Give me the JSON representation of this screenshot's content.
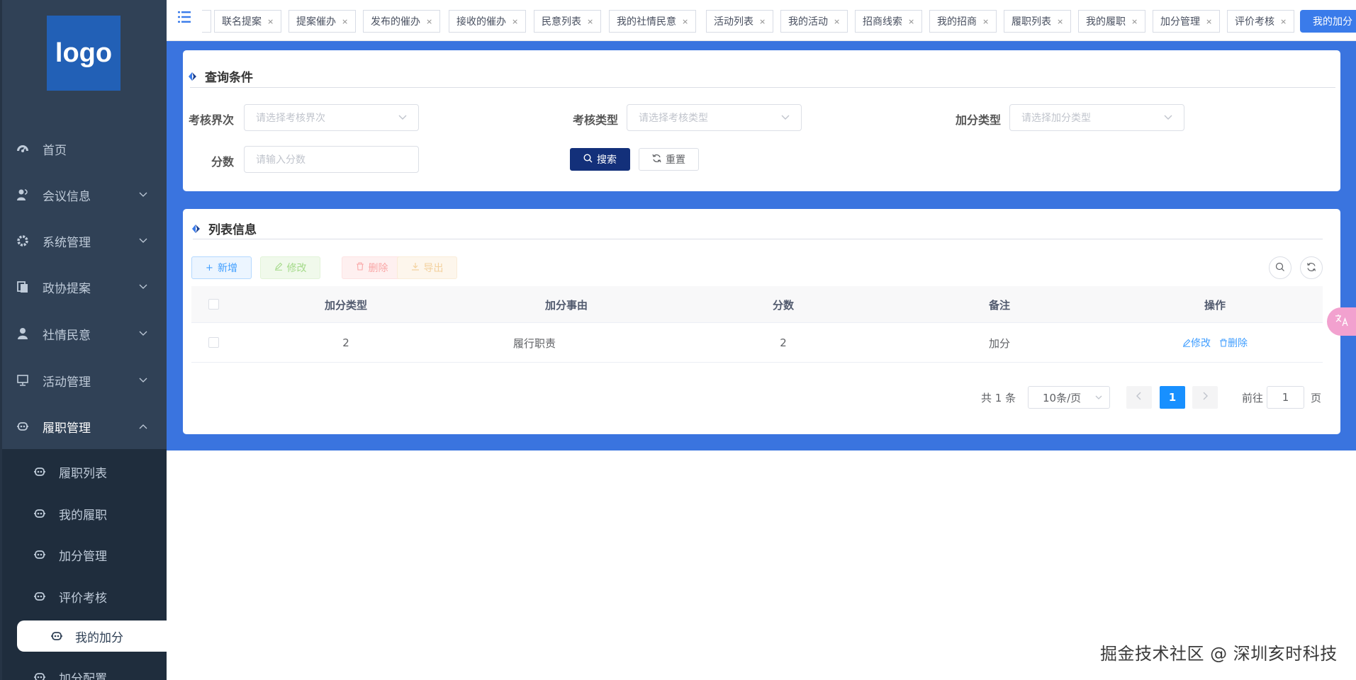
{
  "sidebar": {
    "logo": "logo",
    "items": [
      {
        "label": "首页",
        "icon": "dashboard-icon"
      },
      {
        "label": "会议信息",
        "icon": "user-group-icon"
      },
      {
        "label": "系统管理",
        "icon": "gear-icon"
      },
      {
        "label": "政协提案",
        "icon": "document-icon"
      },
      {
        "label": "社情民意",
        "icon": "person-icon"
      },
      {
        "label": "活动管理",
        "icon": "monitor-icon"
      },
      {
        "label": "履职管理",
        "icon": "robot-icon"
      }
    ],
    "subitems": [
      {
        "label": "履职列表"
      },
      {
        "label": "我的履职"
      },
      {
        "label": "加分管理"
      },
      {
        "label": "评价考核"
      },
      {
        "label": "我的加分"
      },
      {
        "label": "加分配置"
      }
    ],
    "selected": "我的加分"
  },
  "tags": [
    {
      "label": "联名提案"
    },
    {
      "label": "提案催办"
    },
    {
      "label": "发布的催办"
    },
    {
      "label": "接收的催办"
    },
    {
      "label": "民意列表"
    },
    {
      "label": "我的社情民意"
    },
    {
      "label": "活动列表"
    },
    {
      "label": "我的活动"
    },
    {
      "label": "招商线索"
    },
    {
      "label": "我的招商"
    },
    {
      "label": "履职列表"
    },
    {
      "label": "我的履职"
    },
    {
      "label": "加分管理"
    },
    {
      "label": "评价考核"
    },
    {
      "label": "我的加分"
    }
  ],
  "query": {
    "title": "查询条件",
    "fields": [
      {
        "label": "考核界次",
        "placeholder": "请选择考核界次"
      },
      {
        "label": "考核类型",
        "placeholder": "请选择考核类型"
      },
      {
        "label": "加分类型",
        "placeholder": "请选择加分类型"
      },
      {
        "label": "分数",
        "placeholder": "请输入分数"
      }
    ],
    "search_label": "搜索",
    "reset_label": "重置"
  },
  "list": {
    "title": "列表信息",
    "toolbar": {
      "add": "新增",
      "edit": "修改",
      "delete": "删除",
      "export": "导出"
    },
    "columns": [
      "加分类型",
      "加分事由",
      "分数",
      "备注",
      "操作"
    ],
    "rows": [
      {
        "type": "2",
        "reason": "履行职责",
        "score": "2",
        "remark": "加分",
        "edit": "修改",
        "delete": "删除"
      }
    ]
  },
  "pagination": {
    "total": "共 1 条",
    "page_size": "10条/页",
    "current": "1",
    "goto_label": "前往",
    "goto_value": "1",
    "page_suffix": "页"
  },
  "watermark": "掘金技术社区 @ 深圳亥时科技",
  "colors": {
    "sidebar": "#304156",
    "accent_blue": "#3a74df",
    "primary_button": "#13307a",
    "active_page": "#1890ff"
  }
}
